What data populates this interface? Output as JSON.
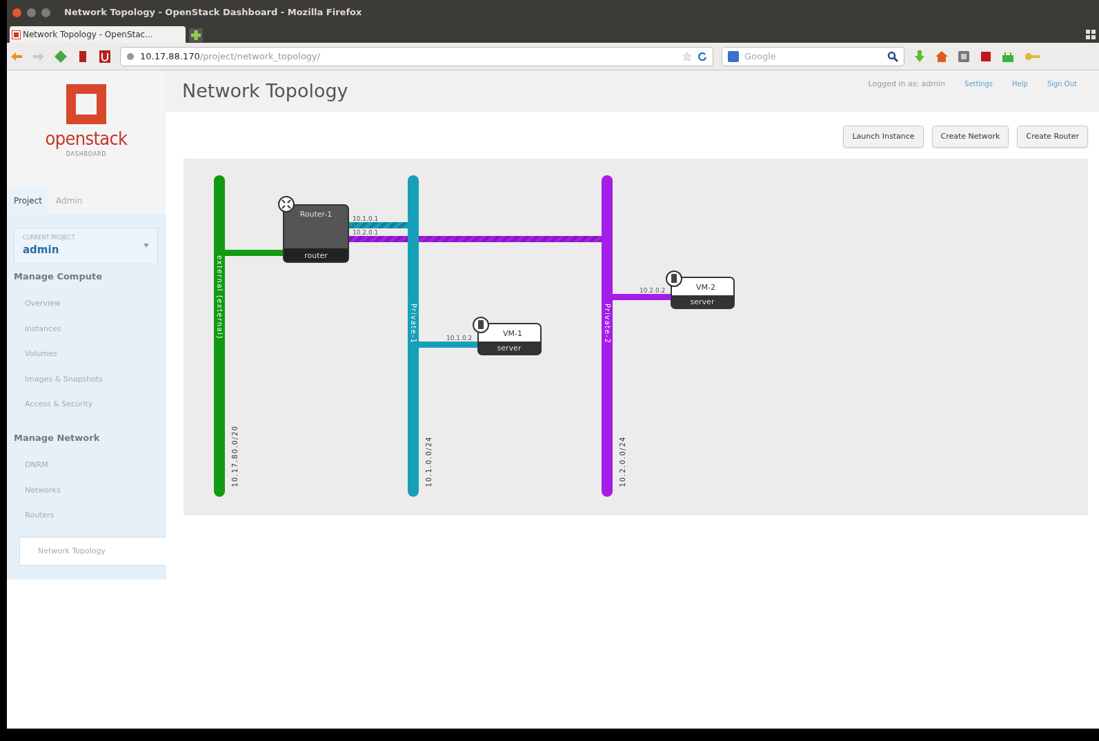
{
  "window": {
    "title": "Network Topology - OpenStack Dashboard - Mozilla Firefox"
  },
  "browser": {
    "tab": "Network Topology - OpenStac...",
    "url_host": "10.17.88.170",
    "url_path": "/project/network_topology/",
    "search_placeholder": "Google"
  },
  "sidebar": {
    "logo": "openstack",
    "logo_sub": "DASHBOARD",
    "tabs": [
      {
        "label": "Project",
        "selected": true
      },
      {
        "label": "Admin",
        "selected": false
      }
    ],
    "project": {
      "label": "CURRENT PROJECT",
      "value": "admin"
    },
    "sections": [
      {
        "title": "Manage Compute",
        "items": [
          {
            "label": "Overview",
            "selected": false
          },
          {
            "label": "Instances",
            "selected": false
          },
          {
            "label": "Volumes",
            "selected": false
          },
          {
            "label": "Images & Snapshots",
            "selected": false
          },
          {
            "label": "Access & Security",
            "selected": false
          }
        ]
      },
      {
        "title": "Manage Network",
        "items": [
          {
            "label": "DNRM",
            "selected": false
          },
          {
            "label": "Networks",
            "selected": false
          },
          {
            "label": "Routers",
            "selected": false
          },
          {
            "label": "Network Topology",
            "selected": true
          }
        ]
      }
    ]
  },
  "header": {
    "title": "Network Topology",
    "logged_in": "Logged in as: admin",
    "links": [
      "Settings",
      "Help",
      "Sign Out"
    ]
  },
  "actions": [
    "Launch Instance",
    "Create Network",
    "Create Router"
  ],
  "topology": {
    "networks": [
      {
        "name": "external (external)",
        "cidr": "10.17.80.0/20",
        "color": "#129a12"
      },
      {
        "name": "Private-1",
        "cidr": "10.1.0.0/24",
        "color": "#169fb8"
      },
      {
        "name": "Private-2",
        "cidr": "10.2.0.0/24",
        "color": "#a41ee8"
      }
    ],
    "router": {
      "name": "Router-1",
      "type": "router",
      "ports": [
        "10.1.0.1",
        "10.2.0.1"
      ]
    },
    "servers": [
      {
        "name": "VM-1",
        "type": "server",
        "ip": "10.1.0.2"
      },
      {
        "name": "VM-2",
        "type": "server",
        "ip": "10.2.0.2"
      }
    ]
  }
}
